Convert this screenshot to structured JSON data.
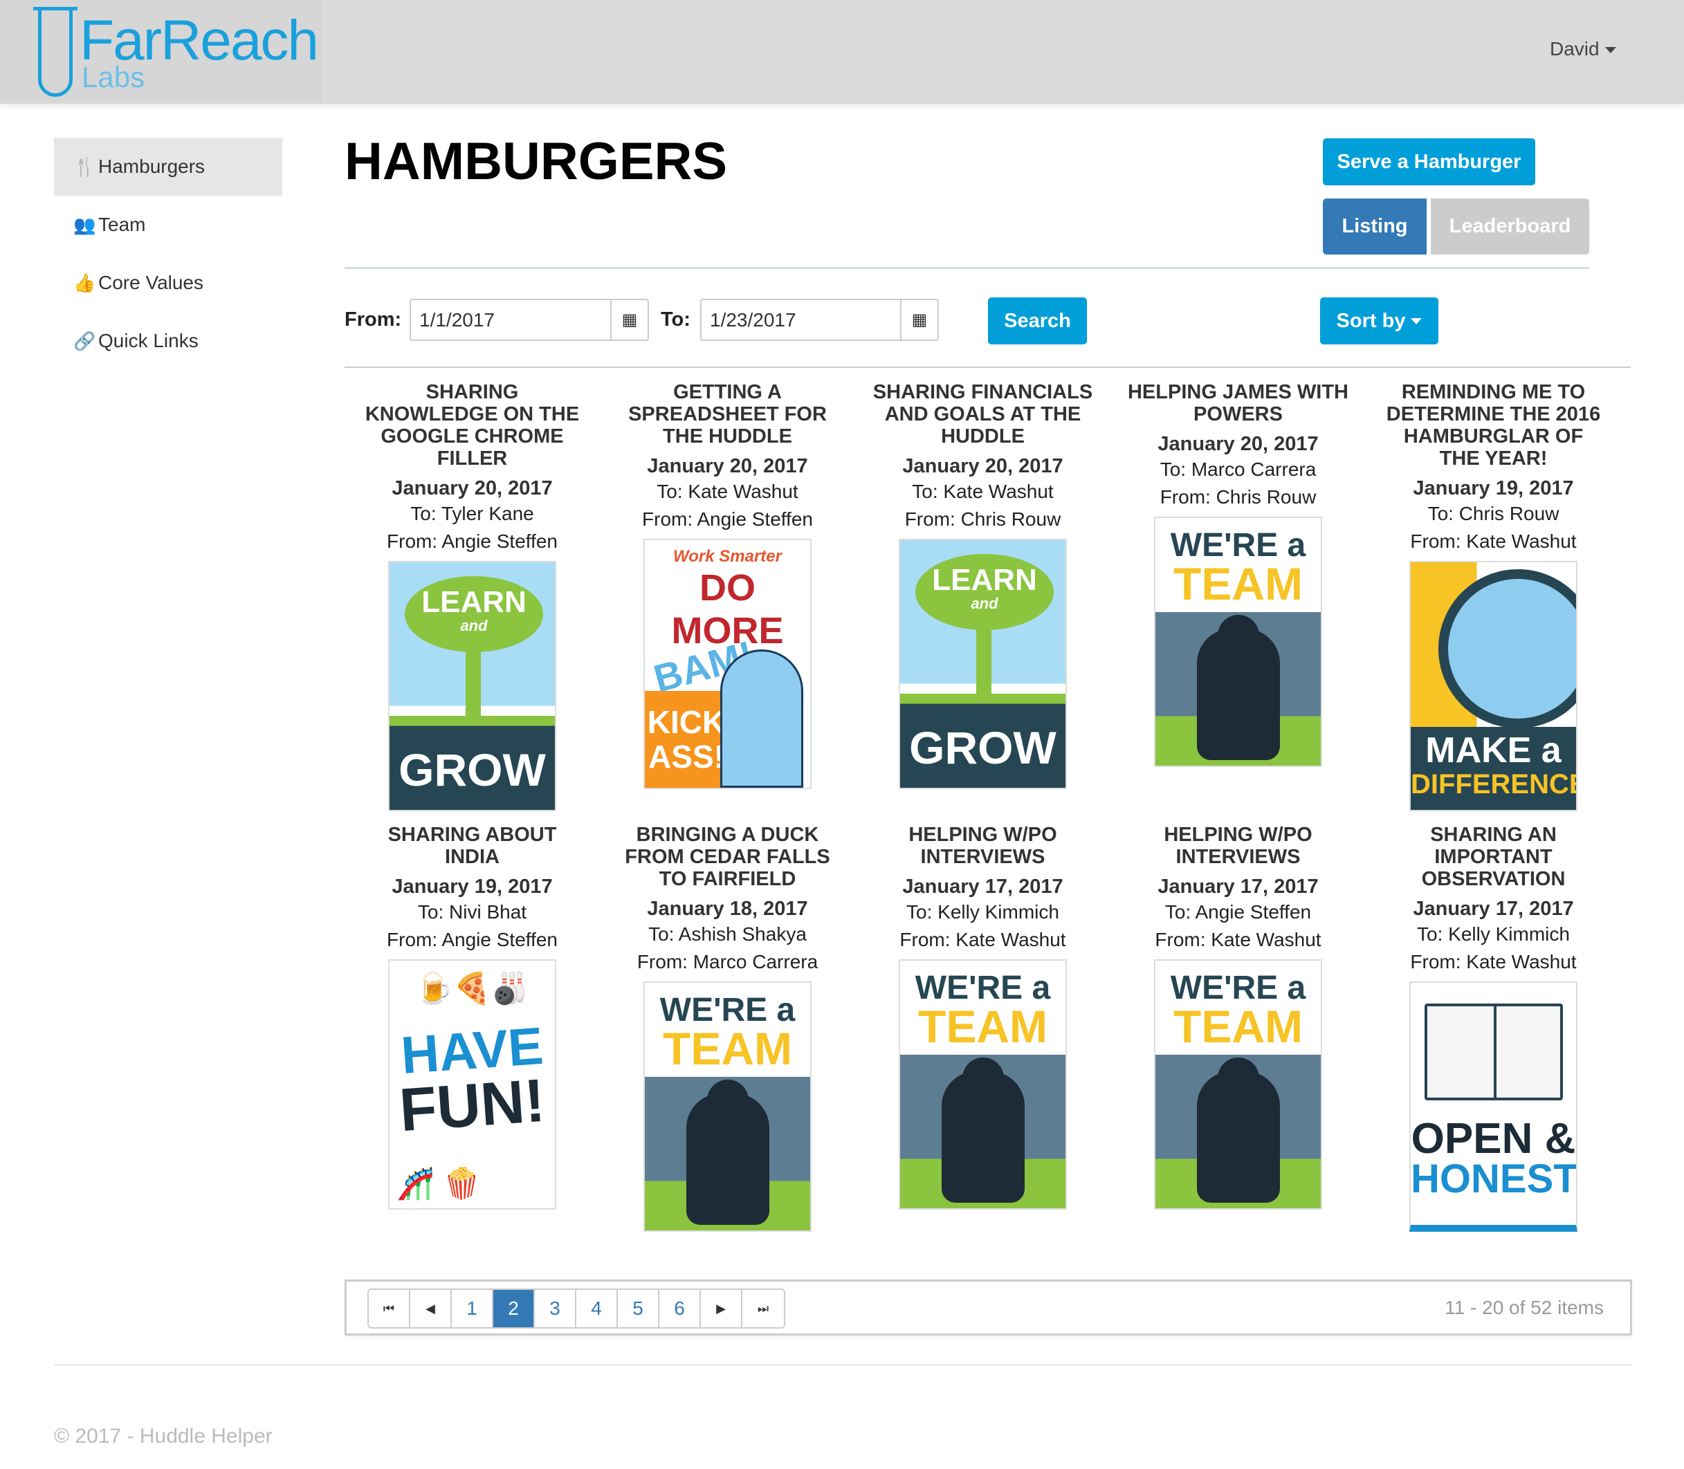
{
  "header": {
    "logo_name": "FarReach",
    "logo_sub": "Labs",
    "user": "David"
  },
  "sidebar": {
    "items": [
      {
        "label": "Hamburgers",
        "icon": "cutlery-icon",
        "active": true
      },
      {
        "label": "Team",
        "icon": "users-icon"
      },
      {
        "label": "Core Values",
        "icon": "thumbs-up-icon"
      },
      {
        "label": "Quick Links",
        "icon": "link-icon"
      }
    ]
  },
  "page": {
    "title": "HAMBURGERS",
    "serve_button": "Serve a Hamburger",
    "tabs": {
      "listing": "Listing",
      "leaderboard": "Leaderboard"
    }
  },
  "filter": {
    "from_label": "From:",
    "from_value": "1/1/2017",
    "to_label": "To:",
    "to_value": "1/23/2017",
    "search_button": "Search",
    "sort_button": "Sort by"
  },
  "cards": [
    {
      "title": "Sharing knowledge on the Google Chrome filler",
      "date": "January 20, 2017",
      "to": "To: Tyler Kane",
      "from": "From: Angie Steffen",
      "poster": "learn-grow",
      "poster_text": [
        "LEARN",
        "and",
        "GROW"
      ]
    },
    {
      "title": "Getting a spreadsheet for the huddle",
      "date": "January 20, 2017",
      "to": "To: Kate Washut",
      "from": "From: Angie Steffen",
      "poster": "do-more",
      "poster_text": [
        "Work Smarter",
        "DO MORE",
        "BAM!",
        "KICK ASS!"
      ]
    },
    {
      "title": "Sharing financials and goals at the huddle",
      "date": "January 20, 2017",
      "to": "To: Kate Washut",
      "from": "From: Chris Rouw",
      "poster": "learn-grow",
      "poster_text": [
        "LEARN",
        "and",
        "GROW"
      ]
    },
    {
      "title": "Helping James with powers",
      "date": "January 20, 2017",
      "to": "To: Marco Carrera",
      "from": "From: Chris Rouw",
      "poster": "team",
      "poster_text": [
        "WE'RE a",
        "TEAM"
      ]
    },
    {
      "title": "Reminding me to determine the 2016 hamburglar of the year!",
      "date": "January 19, 2017",
      "to": "To: Chris Rouw",
      "from": "From: Kate Washut",
      "poster": "make-difference",
      "poster_text": [
        "MAKE a",
        "DIFFERENCE"
      ]
    },
    {
      "title": "Sharing about India",
      "date": "January 19, 2017",
      "to": "To: Nivi Bhat",
      "from": "From: Angie Steffen",
      "poster": "have-fun",
      "poster_text": [
        "HAVE",
        "FUN!"
      ]
    },
    {
      "title": "Bringing a duck from Cedar Falls to Fairfield",
      "date": "January 18, 2017",
      "to": "To: Ashish Shakya",
      "from": "From: Marco Carrera",
      "poster": "team",
      "poster_text": [
        "WE'RE a",
        "TEAM"
      ]
    },
    {
      "title": "Helping w/PO interviews",
      "date": "January 17, 2017",
      "to": "To: Kelly Kimmich",
      "from": "From: Kate Washut",
      "poster": "team",
      "poster_text": [
        "WE'RE a",
        "TEAM"
      ]
    },
    {
      "title": "Helping w/PO interviews",
      "date": "January 17, 2017",
      "to": "To: Angie Steffen",
      "from": "From: Kate Washut",
      "poster": "team",
      "poster_text": [
        "WE'RE a",
        "TEAM"
      ]
    },
    {
      "title": "Sharing an important observation",
      "date": "January 17, 2017",
      "to": "To: Kelly Kimmich",
      "from": "From: Kate Washut",
      "poster": "open-honest",
      "poster_text": [
        "OPEN &",
        "HONEST"
      ]
    }
  ],
  "pagination": {
    "pages": [
      "1",
      "2",
      "3",
      "4",
      "5",
      "6"
    ],
    "current": "2",
    "summary": "11 - 20 of 52 items"
  },
  "footer": {
    "copyright": "© 2017 - Huddle Helper"
  },
  "colors": {
    "primary": "#009fda",
    "active_tab": "#337ab7",
    "header_bg": "#dadada"
  }
}
